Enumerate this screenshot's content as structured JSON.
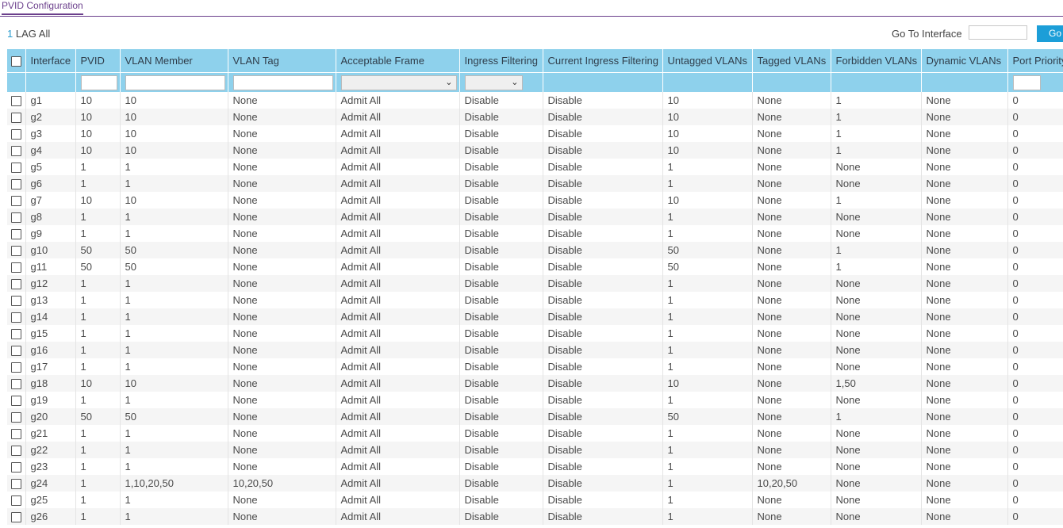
{
  "page": {
    "title_tab": "PVID Configuration",
    "filter_count": "1",
    "filter_lag": "LAG",
    "filter_all": "All",
    "goto_label": "Go To Interface",
    "goto_value": "",
    "go_button": "Go"
  },
  "columns": [
    "Interface",
    "PVID",
    "VLAN Member",
    "VLAN Tag",
    "Acceptable Frame",
    "Ingress Filtering",
    "Current Ingress Filtering",
    "Untagged VLANs",
    "Tagged VLANs",
    "Forbidden VLANs",
    "Dynamic VLANs",
    "Port Priority"
  ],
  "filters": {
    "pvid": "",
    "vlan_member": "",
    "vlan_tag": "",
    "acceptable_frame": "",
    "ingress_filtering": "",
    "port_priority": ""
  },
  "rows": [
    [
      "g1",
      "10",
      "10",
      "None",
      "Admit All",
      "Disable",
      "Disable",
      "10",
      "None",
      "1",
      "None",
      "0"
    ],
    [
      "g2",
      "10",
      "10",
      "None",
      "Admit All",
      "Disable",
      "Disable",
      "10",
      "None",
      "1",
      "None",
      "0"
    ],
    [
      "g3",
      "10",
      "10",
      "None",
      "Admit All",
      "Disable",
      "Disable",
      "10",
      "None",
      "1",
      "None",
      "0"
    ],
    [
      "g4",
      "10",
      "10",
      "None",
      "Admit All",
      "Disable",
      "Disable",
      "10",
      "None",
      "1",
      "None",
      "0"
    ],
    [
      "g5",
      "1",
      "1",
      "None",
      "Admit All",
      "Disable",
      "Disable",
      "1",
      "None",
      "None",
      "None",
      "0"
    ],
    [
      "g6",
      "1",
      "1",
      "None",
      "Admit All",
      "Disable",
      "Disable",
      "1",
      "None",
      "None",
      "None",
      "0"
    ],
    [
      "g7",
      "10",
      "10",
      "None",
      "Admit All",
      "Disable",
      "Disable",
      "10",
      "None",
      "1",
      "None",
      "0"
    ],
    [
      "g8",
      "1",
      "1",
      "None",
      "Admit All",
      "Disable",
      "Disable",
      "1",
      "None",
      "None",
      "None",
      "0"
    ],
    [
      "g9",
      "1",
      "1",
      "None",
      "Admit All",
      "Disable",
      "Disable",
      "1",
      "None",
      "None",
      "None",
      "0"
    ],
    [
      "g10",
      "50",
      "50",
      "None",
      "Admit All",
      "Disable",
      "Disable",
      "50",
      "None",
      "1",
      "None",
      "0"
    ],
    [
      "g11",
      "50",
      "50",
      "None",
      "Admit All",
      "Disable",
      "Disable",
      "50",
      "None",
      "1",
      "None",
      "0"
    ],
    [
      "g12",
      "1",
      "1",
      "None",
      "Admit All",
      "Disable",
      "Disable",
      "1",
      "None",
      "None",
      "None",
      "0"
    ],
    [
      "g13",
      "1",
      "1",
      "None",
      "Admit All",
      "Disable",
      "Disable",
      "1",
      "None",
      "None",
      "None",
      "0"
    ],
    [
      "g14",
      "1",
      "1",
      "None",
      "Admit All",
      "Disable",
      "Disable",
      "1",
      "None",
      "None",
      "None",
      "0"
    ],
    [
      "g15",
      "1",
      "1",
      "None",
      "Admit All",
      "Disable",
      "Disable",
      "1",
      "None",
      "None",
      "None",
      "0"
    ],
    [
      "g16",
      "1",
      "1",
      "None",
      "Admit All",
      "Disable",
      "Disable",
      "1",
      "None",
      "None",
      "None",
      "0"
    ],
    [
      "g17",
      "1",
      "1",
      "None",
      "Admit All",
      "Disable",
      "Disable",
      "1",
      "None",
      "None",
      "None",
      "0"
    ],
    [
      "g18",
      "10",
      "10",
      "None",
      "Admit All",
      "Disable",
      "Disable",
      "10",
      "None",
      "1,50",
      "None",
      "0"
    ],
    [
      "g19",
      "1",
      "1",
      "None",
      "Admit All",
      "Disable",
      "Disable",
      "1",
      "None",
      "None",
      "None",
      "0"
    ],
    [
      "g20",
      "50",
      "50",
      "None",
      "Admit All",
      "Disable",
      "Disable",
      "50",
      "None",
      "1",
      "None",
      "0"
    ],
    [
      "g21",
      "1",
      "1",
      "None",
      "Admit All",
      "Disable",
      "Disable",
      "1",
      "None",
      "None",
      "None",
      "0"
    ],
    [
      "g22",
      "1",
      "1",
      "None",
      "Admit All",
      "Disable",
      "Disable",
      "1",
      "None",
      "None",
      "None",
      "0"
    ],
    [
      "g23",
      "1",
      "1",
      "None",
      "Admit All",
      "Disable",
      "Disable",
      "1",
      "None",
      "None",
      "None",
      "0"
    ],
    [
      "g24",
      "1",
      "1,10,20,50",
      "10,20,50",
      "Admit All",
      "Disable",
      "Disable",
      "1",
      "10,20,50",
      "None",
      "None",
      "0"
    ],
    [
      "g25",
      "1",
      "1",
      "None",
      "Admit All",
      "Disable",
      "Disable",
      "1",
      "None",
      "None",
      "None",
      "0"
    ],
    [
      "g26",
      "1",
      "1",
      "None",
      "Admit All",
      "Disable",
      "Disable",
      "1",
      "None",
      "None",
      "None",
      "0"
    ]
  ],
  "colors": {
    "accent": "#6b3f8c",
    "header_bg": "#8ed1ec",
    "button_bg": "#1c9ed8",
    "link": "#2a9ccf"
  },
  "icons": {
    "checkbox": "checkbox-icon",
    "select_chevron": "chevron-down-icon"
  }
}
